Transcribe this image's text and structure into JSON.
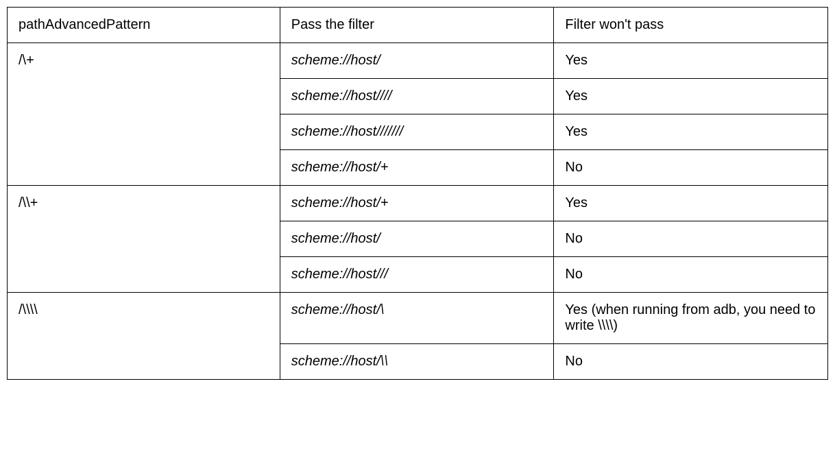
{
  "table": {
    "header": {
      "col1": "pathAdvancedPattern",
      "col2": "Pass the filter",
      "col3": "Filter won't pass"
    },
    "groups": [
      {
        "pattern": "/\\+",
        "rows": [
          {
            "pass": "scheme://host/",
            "result": "Yes"
          },
          {
            "pass": "scheme://host////",
            "result": "Yes"
          },
          {
            "pass": "scheme://host///////",
            "result": "Yes"
          },
          {
            "pass": "scheme://host/+",
            "result": "No"
          }
        ]
      },
      {
        "pattern": "/\\\\+",
        "rows": [
          {
            "pass": "scheme://host/+",
            "result": "Yes"
          },
          {
            "pass": "scheme://host/",
            "result": "No"
          },
          {
            "pass": "scheme://host///",
            "result": "No"
          }
        ]
      },
      {
        "pattern": "/\\\\\\\\",
        "rows": [
          {
            "pass": "scheme://host/\\",
            "result": "Yes (when running from adb, you need to write \\\\\\\\)"
          },
          {
            "pass": "scheme://host/\\\\",
            "result": "No"
          }
        ]
      }
    ]
  }
}
